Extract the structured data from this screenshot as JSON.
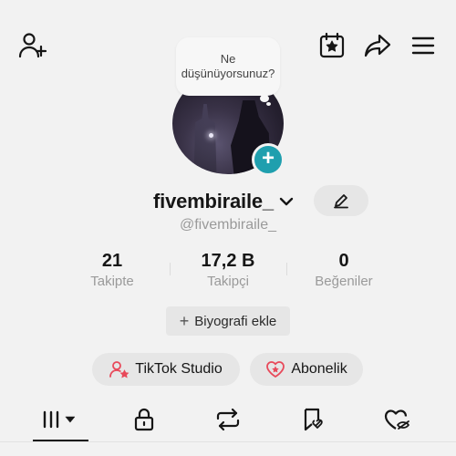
{
  "header": {
    "icons": [
      "add-friend-icon",
      "calendar-star-icon",
      "share-icon",
      "menu-icon"
    ]
  },
  "profile": {
    "bubble_text": "Ne düşünüyorsunuz?",
    "username": "fivembiraile_",
    "handle": "@fivembiraile_",
    "avatar_add_symbol": "+"
  },
  "stats": [
    {
      "value": "21",
      "label": "Takipte"
    },
    {
      "value": "17,2 B",
      "label": "Takipçi"
    },
    {
      "value": "0",
      "label": "Beğeniler"
    }
  ],
  "bio_button": {
    "symbol": "+",
    "label": "Biyografi ekle"
  },
  "actions": {
    "studio_label": "TikTok Studio",
    "subscription_label": "Abonelik"
  },
  "tabs": [
    "videos-grid-icon",
    "lock-icon",
    "repost-icon",
    "favorites-icon",
    "liked-icon"
  ],
  "colors": {
    "accent_teal": "#1f9fae",
    "studio_accent": "#e8495a",
    "text_primary": "#161616",
    "text_secondary": "#9a9a9a"
  }
}
